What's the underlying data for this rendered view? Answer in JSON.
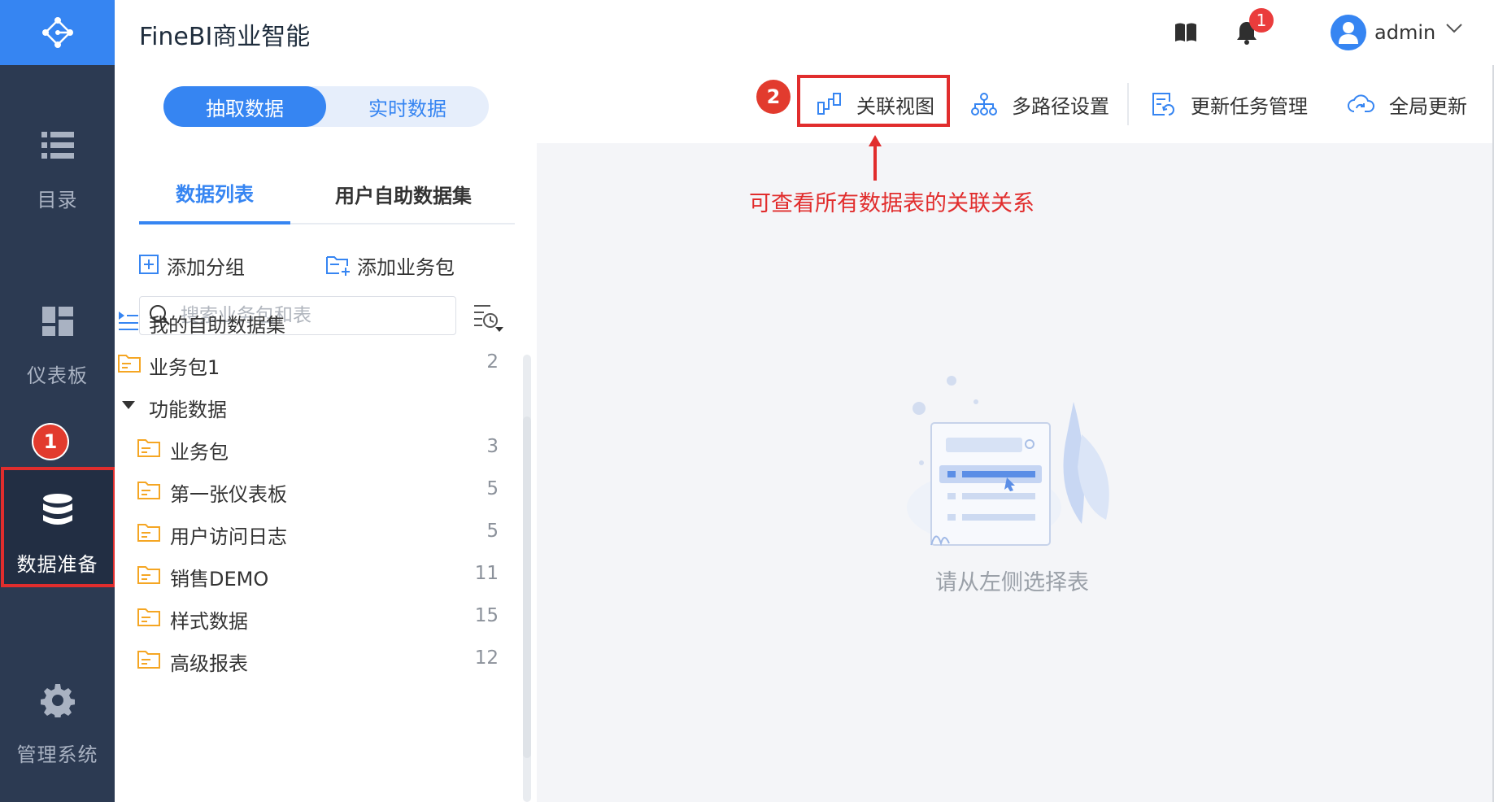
{
  "app": {
    "title": "FineBI商业智能"
  },
  "header": {
    "notification_count": "1",
    "user_name": "admin"
  },
  "nav": {
    "items": [
      {
        "label": "目录",
        "icon": "list-icon"
      },
      {
        "label": "仪表板",
        "icon": "dashboard-icon"
      },
      {
        "label": "数据准备",
        "icon": "database-icon",
        "active": true
      },
      {
        "label": "管理系统",
        "icon": "gear-icon"
      }
    ],
    "step_badge": "1"
  },
  "panel": {
    "segment": {
      "on": "抽取数据",
      "off": "实时数据"
    },
    "tabs": [
      "数据列表",
      "用户自助数据集"
    ],
    "add_group": "添加分组",
    "add_package": "添加业务包",
    "search_placeholder": "搜索业务包和表",
    "tree": [
      {
        "label": "我的自助数据集",
        "count": "",
        "type": "self-service"
      },
      {
        "label": "业务包1",
        "count": "2",
        "type": "folder"
      },
      {
        "label": "功能数据",
        "count": "",
        "type": "group"
      },
      {
        "label": "业务包",
        "count": "3",
        "type": "folder"
      },
      {
        "label": "第一张仪表板",
        "count": "5",
        "type": "folder"
      },
      {
        "label": "用户访问日志",
        "count": "5",
        "type": "folder"
      },
      {
        "label": "销售DEMO",
        "count": "11",
        "type": "folder"
      },
      {
        "label": "样式数据",
        "count": "15",
        "type": "folder"
      },
      {
        "label": "高级报表",
        "count": "12",
        "type": "folder"
      }
    ]
  },
  "toolbar": {
    "step_badge": "2",
    "relation_view": "关联视图",
    "multipath": "多路径设置",
    "task_mgmt": "更新任务管理",
    "global_update": "全局更新"
  },
  "main": {
    "annotation": "可查看所有数据表的关联关系",
    "empty_text": "请从左侧选择表"
  },
  "colors": {
    "brand": "#3685f2",
    "nav_bg": "#2c3a52",
    "highlight": "#e12d2d",
    "folder": "#f5a623"
  }
}
